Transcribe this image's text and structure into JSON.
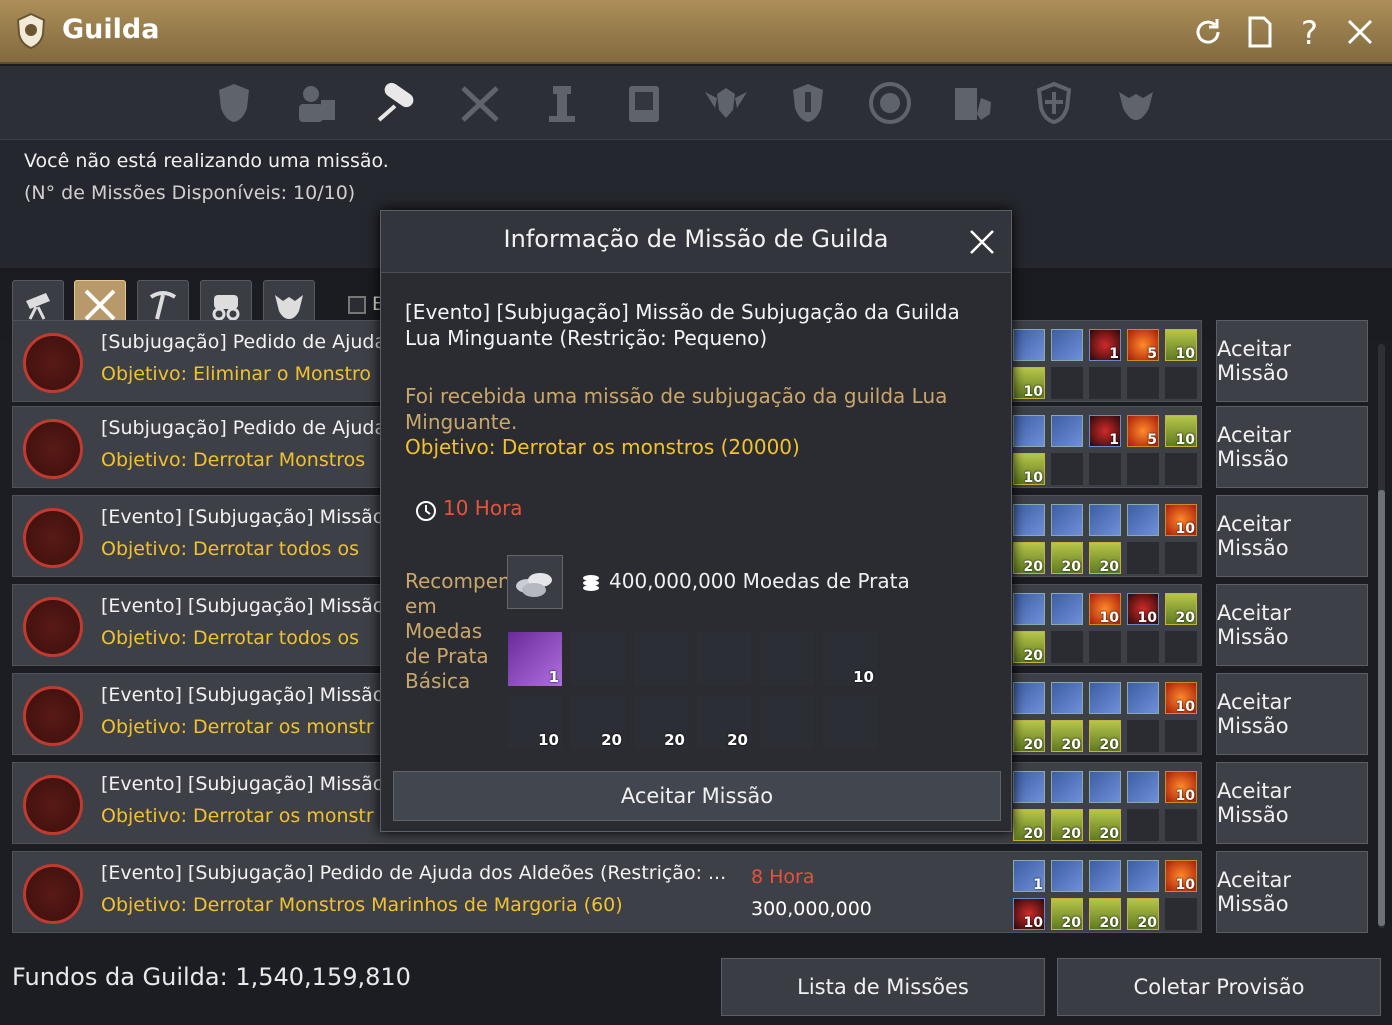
{
  "window": {
    "title": "Guilda",
    "icons": [
      "guild-emblem-icon",
      "refresh-icon",
      "page-icon",
      "help-icon",
      "close-icon"
    ]
  },
  "tabs": [
    {
      "icon": "guild-crest-icon"
    },
    {
      "icon": "members-icon"
    },
    {
      "icon": "mission-scroll-icon",
      "active": true
    },
    {
      "icon": "crossed-tools-icon"
    },
    {
      "icon": "tower-icon"
    },
    {
      "icon": "board-icon"
    },
    {
      "icon": "wings-shield-icon"
    },
    {
      "icon": "shield-icon"
    },
    {
      "icon": "round-shield-icon"
    },
    {
      "icon": "building-shield-icon"
    },
    {
      "icon": "crest-badge-icon"
    },
    {
      "icon": "beast-head-icon"
    }
  ],
  "status": {
    "line1": "Você não está realizando uma missão.",
    "line2": "(N° de Missões Disponíveis: 10/10)"
  },
  "filters": {
    "buttons": [
      {
        "icon": "telescope-icon",
        "active": false
      },
      {
        "icon": "crossed-swords-icon",
        "active": true
      },
      {
        "icon": "pickaxe-icon",
        "active": false
      },
      {
        "icon": "carriage-icon",
        "active": false
      },
      {
        "icon": "monster-icon",
        "active": false
      }
    ],
    "checkbox_label": "E"
  },
  "missions": [
    {
      "title": "[Subjugação] Pedido de Ajuda",
      "objective": "Objetivo: Eliminar o Monstro",
      "time": "",
      "prize": "",
      "button": "Aceitar Missão"
    },
    {
      "title": "[Subjugação] Pedido de Ajuda",
      "objective": "Objetivo: Derrotar Monstros",
      "time": "",
      "prize": "",
      "button": "Aceitar Missão"
    },
    {
      "title": "[Evento] [Subjugação] Missão",
      "objective": "Objetivo: Derrotar todos os",
      "time": "",
      "prize": "",
      "button": "Aceitar Missão"
    },
    {
      "title": "[Evento] [Subjugação] Missão",
      "objective": "Objetivo: Derrotar todos os",
      "time": "",
      "prize": "",
      "button": "Aceitar Missão"
    },
    {
      "title": "[Evento] [Subjugação] Missão",
      "objective": "Objetivo: Derrotar os monstr",
      "time": "",
      "prize": "",
      "button": "Aceitar Missão"
    },
    {
      "title": "[Evento] [Subjugação] Missão",
      "objective": "Objetivo: Derrotar os monstr",
      "time": "",
      "prize": "",
      "button": "Aceitar Missão"
    },
    {
      "title": "[Evento] [Subjugação] Pedido de Ajuda dos Aldeões (Restrição: ...",
      "objective": "Objetivo: Derrotar Monstros Marinhos de Margoria (60)",
      "time": "8 Hora",
      "prize": "300,000,000",
      "button": "Aceitar Missão"
    }
  ],
  "row_slots": [
    [
      "fill",
      "fill",
      "orb:1",
      "red:5",
      "drink:10",
      "drink:10",
      "",
      "",
      "",
      ""
    ],
    [
      "fill",
      "fill",
      "orb:1",
      "red:5",
      "drink:10",
      "drink:10",
      "",
      "",
      "",
      ""
    ],
    [
      "fill",
      "fill",
      "fill",
      "fill",
      "red:10",
      "drink:20",
      "drink:20",
      "drink:20",
      "",
      ""
    ],
    [
      "fill",
      "fill",
      "red:10",
      "orb:10",
      "drink:20",
      "drink:20",
      "",
      "",
      "",
      ""
    ],
    [
      "fill",
      "fill",
      "fill",
      "fill",
      "red:10",
      "drink:20",
      "drink:20",
      "drink:20",
      "",
      ""
    ],
    [
      "fill",
      "fill",
      "fill",
      "fill",
      "red:10",
      "drink:20",
      "drink:20",
      "drink:20",
      "",
      ""
    ],
    [
      "fill:1",
      "fill",
      "fill",
      "fill",
      "red:10",
      "orb:10",
      "drink:20",
      "drink:20",
      "drink:20",
      ""
    ]
  ],
  "modal": {
    "title": "Informação de Missão de Guilda",
    "mission_title": "[Evento] [Subjugação] Missão de Subjugação da Guilda Lua Minguante (Restrição: Pequeno)",
    "description": "Foi recebida uma missão de subjugação da guilda Lua Minguante.",
    "objective": "Objetivo: Derrotar os monstros (20000)",
    "time": "10 Hora",
    "reward_label": "Recompensa em Moedas de Prata Básica",
    "silver": "400,000,000 Moedas de Prata",
    "reward_items": [
      {
        "kind": "purple",
        "qty": "1"
      },
      {
        "kind": "exp",
        "qty": ""
      },
      {
        "kind": "exp",
        "qty": ""
      },
      {
        "kind": "exp",
        "qty": ""
      },
      {
        "kind": "exp",
        "qty": ""
      },
      {
        "kind": "red",
        "qty": "10"
      },
      {
        "kind": "orb",
        "qty": "10"
      },
      {
        "kind": "drink",
        "qty": "20"
      },
      {
        "kind": "drink-red",
        "qty": "20"
      },
      {
        "kind": "drink-green",
        "qty": "20"
      },
      {
        "kind": "empty",
        "qty": ""
      },
      {
        "kind": "empty",
        "qty": ""
      }
    ],
    "accept": "Aceitar Missão"
  },
  "footer": {
    "funds": "Fundos da Guilda: 1,540,159,810",
    "list_button": "Lista de Missões",
    "collect_button": "Coletar Provisão"
  },
  "colors": {
    "accent_gold": "#f2c12e",
    "time_red": "#e8523a",
    "titlebar": "#ac8f58"
  }
}
